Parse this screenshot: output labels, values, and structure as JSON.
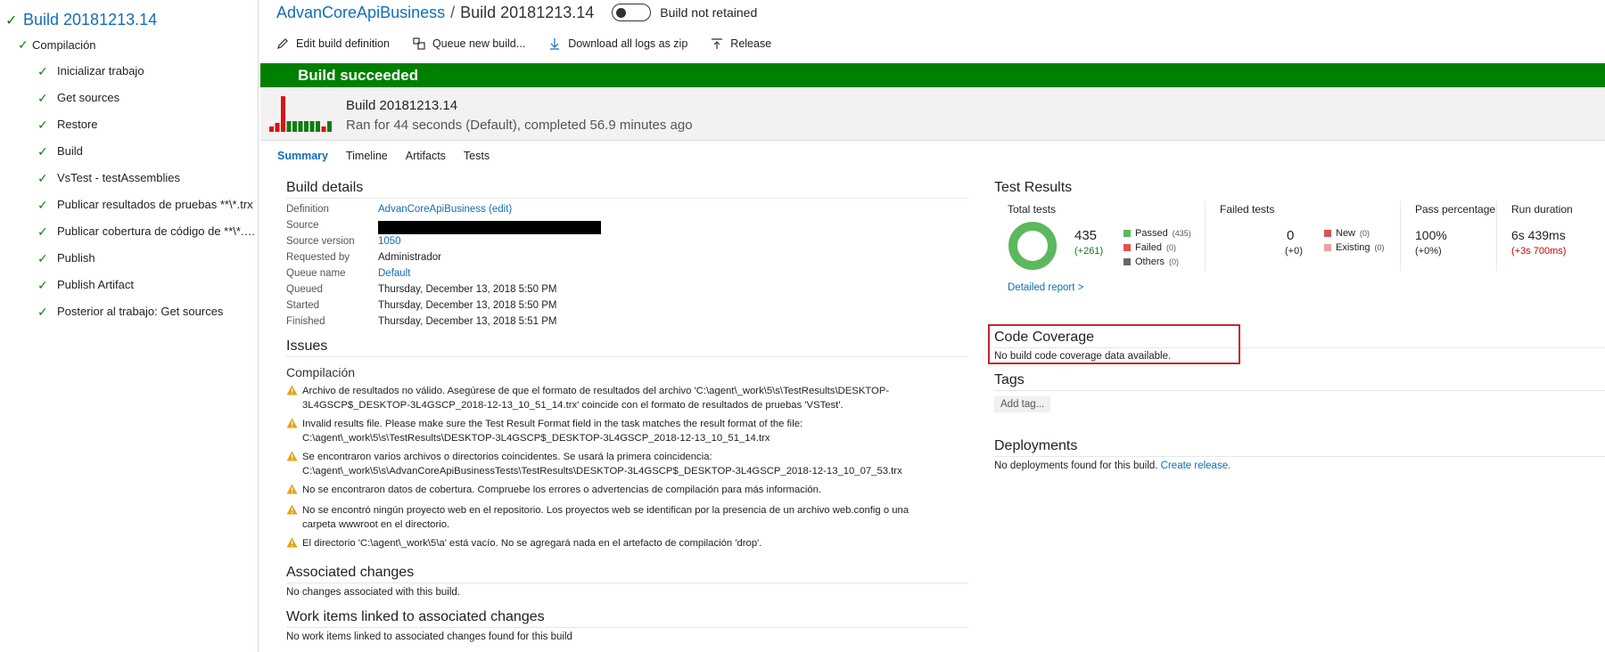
{
  "sidebar": {
    "root_label": "Build 20181213.14",
    "job_label": "Compilación",
    "steps": [
      "Inicializar trabajo",
      "Get sources",
      "Restore",
      "Build",
      "VsTest - testAssemblies",
      "Publicar resultados de pruebas **\\*.trx",
      "Publicar cobertura de código de **\\*.…",
      "Publish",
      "Publish Artifact",
      "Posterior al trabajo: Get sources"
    ]
  },
  "header": {
    "definition": "AdvanCoreApiBusiness",
    "separator": "/",
    "build": "Build 20181213.14",
    "toggle_label": "Build not retained"
  },
  "toolbar": {
    "edit": "Edit build definition",
    "queue": "Queue new build...",
    "download": "Download all logs as zip",
    "release": "Release"
  },
  "banner": {
    "status": "Build succeeded",
    "color": "#008000"
  },
  "build_info": {
    "number": "Build 20181213.14",
    "summary": "Ran for 44 seconds (Default), completed 56.9 minutes ago",
    "history_bars": [
      {
        "value": 0.15,
        "status": "failed"
      },
      {
        "value": 0.25,
        "status": "failed"
      },
      {
        "value": 1.0,
        "status": "failed"
      },
      {
        "value": 0.3,
        "status": "succeeded"
      },
      {
        "value": 0.3,
        "status": "succeeded"
      },
      {
        "value": 0.3,
        "status": "succeeded"
      },
      {
        "value": 0.3,
        "status": "succeeded"
      },
      {
        "value": 0.3,
        "status": "succeeded"
      },
      {
        "value": 0.3,
        "status": "succeeded"
      },
      {
        "value": 0.15,
        "status": "failed"
      },
      {
        "value": 0.3,
        "status": "succeeded"
      }
    ]
  },
  "tabs": [
    "Summary",
    "Timeline",
    "Artifacts",
    "Tests"
  ],
  "build_details": {
    "title": "Build details",
    "rows": {
      "definition_key": "Definition",
      "definition_val": "AdvanCoreApiBusiness (edit)",
      "source_key": "Source",
      "source_version_key": "Source version",
      "source_version_val": "1050",
      "requested_by_key": "Requested by",
      "requested_by_val": "Administrador",
      "queue_name_key": "Queue name",
      "queue_name_val": "Default",
      "queued_key": "Queued",
      "queued_val": "Thursday, December 13, 2018 5:50 PM",
      "started_key": "Started",
      "started_val": "Thursday, December 13, 2018 5:50 PM",
      "finished_key": "Finished",
      "finished_val": "Thursday, December 13, 2018 5:51 PM"
    }
  },
  "issues": {
    "title": "Issues",
    "sub": "Compilación",
    "items": [
      [
        "Archivo de resultados no válido. Asegúrese de que el formato de resultados del archivo 'C:\\agent\\_work\\5\\s\\TestResults\\DESKTOP-",
        "3L4GSCP$_DESKTOP-3L4GSCP_2018-12-13_10_51_14.trx' coincide con el formato de resultados de pruebas 'VSTest'."
      ],
      [
        "Invalid results file. Please make sure the Test Result Format field in the task matches the result format of the file:",
        "C:\\agent\\_work\\5\\s\\TestResults\\DESKTOP-3L4GSCP$_DESKTOP-3L4GSCP_2018-12-13_10_51_14.trx"
      ],
      [
        "Se encontraron varios archivos o directorios coincidentes. Se usará la primera coincidencia:",
        "C:\\agent\\_work\\5\\s\\AdvanCoreApiBusinessTests\\TestResults\\DESKTOP-3L4GSCP$_DESKTOP-3L4GSCP_2018-12-13_10_07_53.trx"
      ],
      [
        "No se encontraron datos de cobertura. Compruebe los errores o advertencias de compilación para más información.",
        ""
      ],
      [
        "No se encontró ningún proyecto web en el repositorio. Los proyectos web se identifican por la presencia de un archivo web.config o una",
        "carpeta wwwroot en el directorio."
      ],
      [
        "El directorio 'C:\\agent\\_work\\5\\a' está vacío. No se agregará nada en el artefacto de compilación 'drop'.",
        ""
      ]
    ]
  },
  "associated_changes": {
    "title": "Associated changes",
    "text": "No changes associated with this build."
  },
  "work_items": {
    "title": "Work items linked to associated changes",
    "text": "No work items linked to associated changes found for this build"
  },
  "test_results": {
    "title": "Test Results",
    "total_label": "Total tests",
    "total": "435",
    "total_delta": "(+261)",
    "passed_label": "Passed",
    "passed_count": "(435)",
    "failed_label": "Failed",
    "failed_count": "(0)",
    "others_label": "Others",
    "others_count": "(0)",
    "failed_tests_label": "Failed tests",
    "failed_tests": "0",
    "failed_tests_delta": "(+0)",
    "new_label": "New",
    "new_count": "(0)",
    "existing_label": "Existing",
    "existing_count": "(0)",
    "pass_pct_label": "Pass percentage",
    "pass_pct": "100%",
    "pass_pct_delta": "(+0%)",
    "duration_label": "Run duration",
    "duration": "6s 439ms",
    "duration_delta": "(+3s 700ms)",
    "detailed_report": "Detailed report >",
    "colors": {
      "passed": "#5cb85c",
      "failed": "#e05050",
      "others": "#666666",
      "new": "#e05050",
      "existing": "#f0a0a0"
    }
  },
  "code_coverage": {
    "title": "Code Coverage",
    "text": "No build code coverage data available."
  },
  "tags": {
    "title": "Tags",
    "add_placeholder": "Add tag..."
  },
  "deployments": {
    "title": "Deployments",
    "text": "No deployments found for this build.",
    "link": "Create release."
  }
}
